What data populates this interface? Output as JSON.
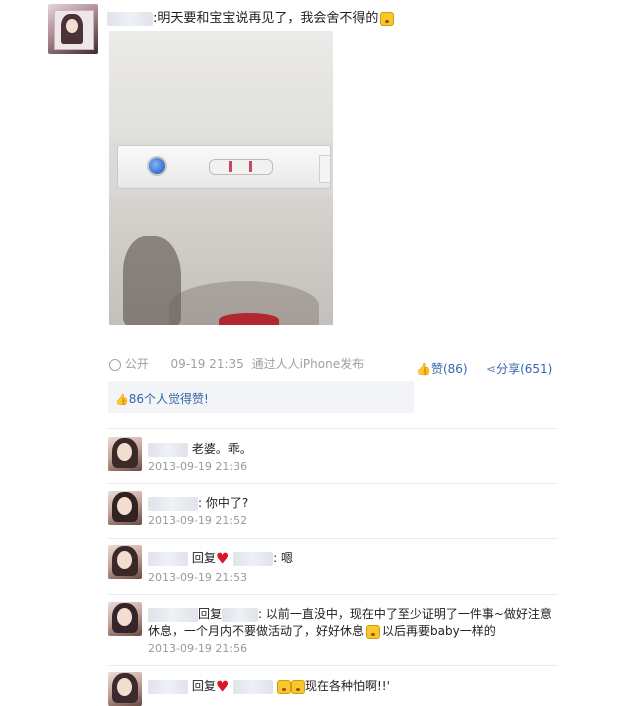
{
  "post": {
    "author_suffix": ":",
    "text": "明天要和宝宝说再见了，我会舍不得的",
    "meta": {
      "privacy": "公开",
      "time": "09-19 21:35",
      "via": "通过人人iPhone发布",
      "like_label": "赞(86)",
      "share_label": "分享(651)",
      "like_count_text": "86个人觉得赞!"
    }
  },
  "icons": {
    "like": "thumbs-up-icon",
    "share": "share-icon",
    "privacy": "globe-icon",
    "emoji": "emoji-face-icon",
    "heart": "heart-icon"
  },
  "colors": {
    "link": "#3366aa",
    "heart": "#d8162c",
    "emoji": "#f6c829"
  },
  "comments": [
    {
      "text": "老婆。乖。",
      "time": "2013-09-19 21:36"
    },
    {
      "text": ": 你中了?",
      "time": "2013-09-19 21:52"
    },
    {
      "reply": "回复",
      "text": ": 嗯",
      "time": "2013-09-19 21:53"
    },
    {
      "reply": "回复",
      "text_line1": ": 以前一直没中，现在中了至少证明了一件事~做好注意",
      "text_line2": "休息，一个月内不要做活动了，好好休息",
      "text_line2b": "以后再要baby一样的",
      "time": "2013-09-19 21:56"
    },
    {
      "reply": "回复",
      "text": "现在各种怕啊!!'"
    }
  ]
}
